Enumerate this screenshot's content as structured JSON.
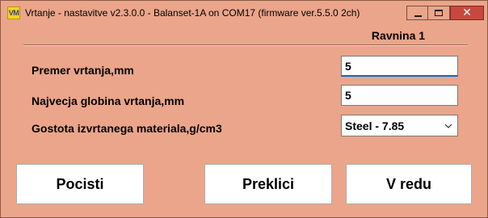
{
  "window": {
    "app_icon_text": "VM",
    "title": "Vrtanje - nastavitve v2.3.0.0 - Balanset-1A on COM17 (firmware ver.5.5.0 2ch)",
    "close_glyph": "✕"
  },
  "header": {
    "plane_label": "Ravnina 1"
  },
  "fields": {
    "diameter": {
      "label": "Premer vrtanja,mm",
      "value": "5"
    },
    "max_depth": {
      "label": "Najvecja globina vrtanja,mm",
      "value": "5"
    },
    "density": {
      "label": "Gostota izvrtanega materiala,g/cm3",
      "selected": "Steel - 7.85"
    }
  },
  "buttons": {
    "clear": "Pocisti",
    "cancel": "Preklici",
    "ok": "V redu"
  },
  "colors": {
    "background": "#eba58a",
    "close_button": "#c9483e",
    "focus_underline": "#0b6bc4"
  }
}
